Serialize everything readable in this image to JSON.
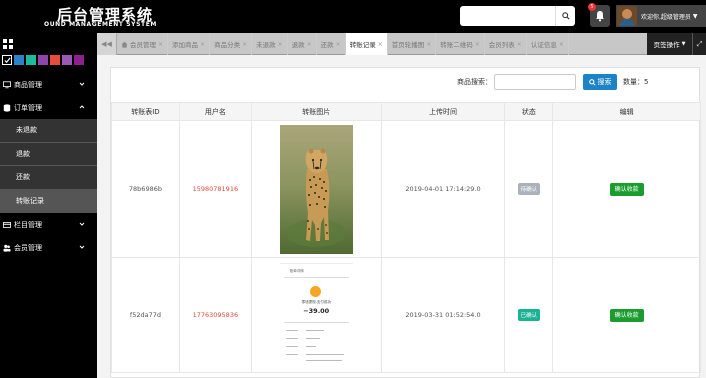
{
  "header": {
    "title": "后台管理系统",
    "subtitle": "OUND MANAGEMENT SYSTEM",
    "search_placeholder": "",
    "bell_count": "5",
    "user_greeting": "欢迎你,超级管理员"
  },
  "sidebar": {
    "theme_colors": [
      "#000000",
      "#2c82c9",
      "#1abc9c",
      "#8e44ad",
      "#e74c3c",
      "#9b59b6",
      "#8e1f8e"
    ],
    "menus": [
      {
        "label": "商品管理",
        "icon": "monitor-icon",
        "expanded": false
      },
      {
        "label": "订单管理",
        "icon": "database-icon",
        "expanded": true,
        "children": [
          "未退款",
          "退款",
          "还款",
          "转账记录"
        ]
      },
      {
        "label": "栏目管理",
        "icon": "card-icon",
        "expanded": false
      },
      {
        "label": "会员管理",
        "icon": "users-icon",
        "expanded": false
      }
    ]
  },
  "tabs": {
    "items": [
      "会员管理",
      "添加商品",
      "商品分类",
      "未退款",
      "退款",
      "还款",
      "转账记录",
      "首页轮播图",
      "转账二维码",
      "会员列表",
      "认证信息"
    ],
    "active_index": 6,
    "ops_label": "页签操作"
  },
  "search": {
    "label": "商品搜索：",
    "input_value": "",
    "button_label": "搜索",
    "count_label": "数量：5"
  },
  "table": {
    "headers": [
      "转账表ID",
      "用户名",
      "转账图片",
      "上传时间",
      "状态",
      "编辑"
    ],
    "rows": [
      {
        "id": "78b6986b",
        "username": "15980781916",
        "image": "cheetah-photo",
        "time": "2019-04-01 17:14:29.0",
        "status": "待确认",
        "status_type": "pending",
        "action": "确认收款"
      },
      {
        "id": "f52da77d",
        "username": "17763095836",
        "image": "payment-receipt",
        "time": "2019-03-31 01:52:54.0",
        "status": "已确认",
        "status_type": "confirmed",
        "action": "确认收款"
      }
    ]
  },
  "receipt": {
    "header_text": "账单详情",
    "title": "零钱提现-支付成功",
    "amount": "−39.00"
  }
}
